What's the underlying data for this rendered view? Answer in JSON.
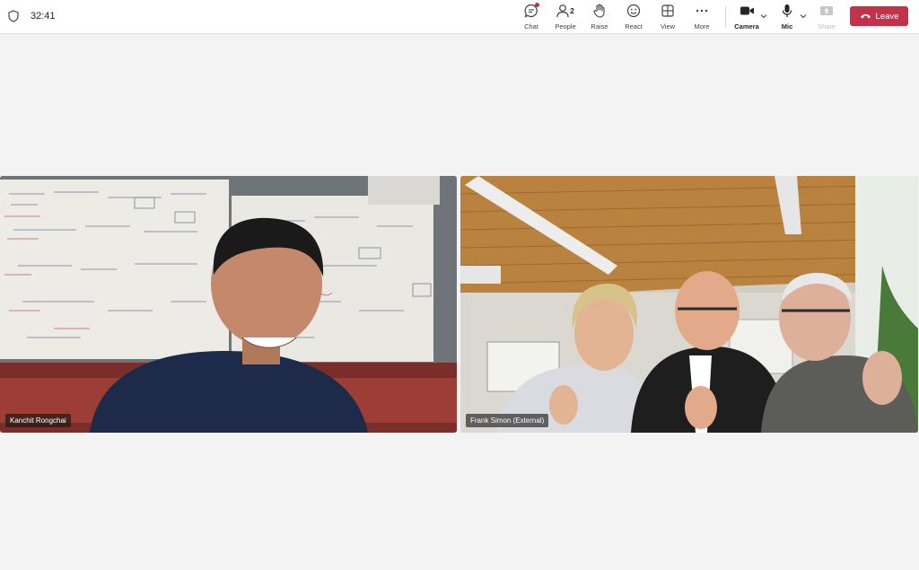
{
  "header": {
    "timer": "32:41"
  },
  "toolbar": {
    "chat": {
      "label": "Chat",
      "icon": "chat-icon"
    },
    "people": {
      "label": "People",
      "count": "2",
      "icon": "people-icon"
    },
    "raise": {
      "label": "Raise",
      "icon": "hand-icon"
    },
    "react": {
      "label": "React",
      "icon": "smiley-icon"
    },
    "view": {
      "label": "View",
      "icon": "grid-icon"
    },
    "more": {
      "label": "More",
      "icon": "ellipsis-icon"
    },
    "camera": {
      "label": "Camera",
      "icon": "camera-icon"
    },
    "mic": {
      "label": "Mic",
      "icon": "mic-icon"
    },
    "share": {
      "label": "Share",
      "icon": "share-icon"
    },
    "leave": {
      "label": "Leave",
      "icon": "phone-hangup-icon"
    }
  },
  "participants": [
    {
      "name": "Kanchit Rongchai"
    },
    {
      "name": "Frank Simon (External)"
    }
  ],
  "colors": {
    "leave_red": "#c4314b",
    "background": "#f3f3f3"
  }
}
